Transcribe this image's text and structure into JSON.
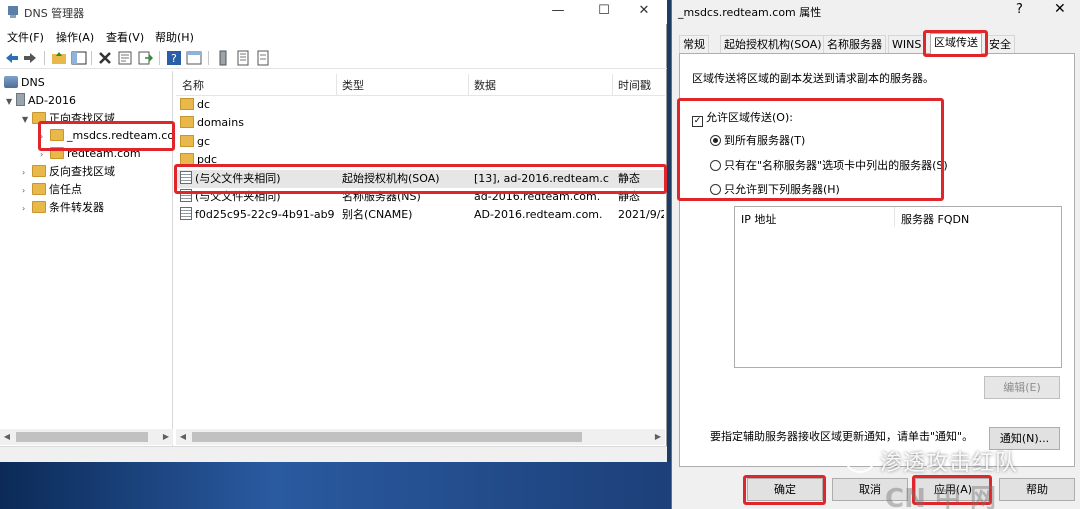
{
  "dns_window": {
    "title": "DNS 管理器",
    "controls": {
      "minimize": "—",
      "maximize": "☐",
      "close": "✕"
    },
    "menu": [
      "文件(F)",
      "操作(A)",
      "查看(V)",
      "帮助(H)"
    ],
    "tree": {
      "root": "DNS",
      "server": "AD-2016",
      "forward_zones": "正向查找区域",
      "zone_msdcs": "_msdcs.redteam.co",
      "zone_redteam": "redteam.com",
      "reverse_zones": "反向查找区域",
      "trust_points": "信任点",
      "conditional_forwarders": "条件转发器"
    },
    "list": {
      "columns": [
        "名称",
        "类型",
        "数据",
        "时间戳"
      ],
      "folders": [
        "dc",
        "domains",
        "gc",
        "pdc"
      ],
      "records": [
        {
          "name": "(与父文件夹相同)",
          "type": "起始授权机构(SOA)",
          "data": "[13], ad-2016.redteam.c...",
          "timestamp": "静态"
        },
        {
          "name": "(与父文件夹相同)",
          "type": "名称服务器(NS)",
          "data": "ad-2016.redteam.com.",
          "timestamp": "静态"
        },
        {
          "name": "f0d25c95-22c9-4b91-ab9...",
          "type": "别名(CNAME)",
          "data": "AD-2016.redteam.com.",
          "timestamp": "2021/9/2"
        }
      ]
    }
  },
  "dialog": {
    "title": "_msdcs.redteam.com 属性",
    "help_glyph": "?",
    "close_glyph": "✕",
    "tabs": [
      "常规",
      "起始授权机构(SOA)",
      "名称服务器",
      "WINS",
      "区域传送",
      "安全"
    ],
    "active_tab": "区域传送",
    "description": "区域传送将区域的副本发送到请求副本的服务器。",
    "allow_transfer_label": "允许区域传送(O):",
    "allow_transfer_checked": true,
    "radios": [
      {
        "label": "到所有服务器(T)",
        "selected": true
      },
      {
        "label": "只有在\"名称服务器\"选项卡中列出的服务器(S)",
        "selected": false
      },
      {
        "label": "只允许到下列服务器(H)",
        "selected": false
      }
    ],
    "ip_table_headers": [
      "IP 地址",
      "服务器 FQDN"
    ],
    "edit_button": "编辑(E)",
    "notify_text": "要指定辅助服务器接收区域更新通知，请单击\"通知\"。",
    "notify_button": "通知(N)...",
    "buttons": {
      "ok": "确定",
      "cancel": "取消",
      "apply": "应用(A)",
      "help": "帮助"
    }
  },
  "watermark": {
    "text": "渗透攻击红队",
    "text2": "CN 中 网"
  },
  "colors": {
    "highlight": "#e0262a",
    "folder": "#e8b84a",
    "selected_row": "#e6e6e6"
  }
}
